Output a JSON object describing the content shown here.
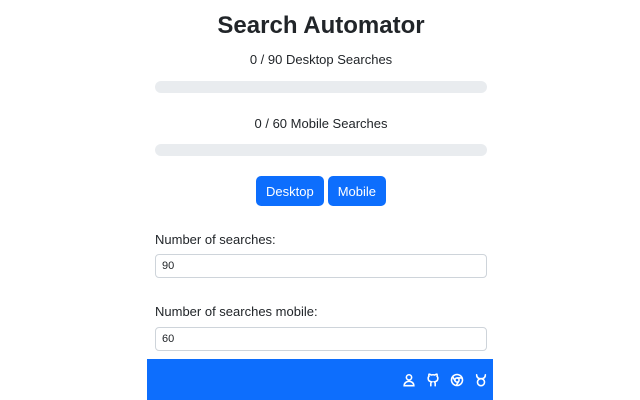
{
  "header": {
    "title": "Search Automator"
  },
  "progress": {
    "desktop": {
      "label": "0 / 90 Desktop Searches",
      "done": 0,
      "total": 90
    },
    "mobile": {
      "label": "0 / 60 Mobile Searches",
      "done": 0,
      "total": 60
    }
  },
  "buttons": {
    "desktop_label": "Desktop",
    "mobile_label": "Mobile"
  },
  "fields": {
    "desktop": {
      "label": "Number of searches:",
      "value": "90"
    },
    "mobile": {
      "label": "Number of searches mobile:",
      "value": "60"
    }
  },
  "footer": {
    "icons": [
      "account-icon",
      "github-icon",
      "chrome-icon",
      "taurus-icon"
    ]
  },
  "colors": {
    "primary": "#0d6efd",
    "track": "#e9ecef",
    "text": "#212529"
  }
}
